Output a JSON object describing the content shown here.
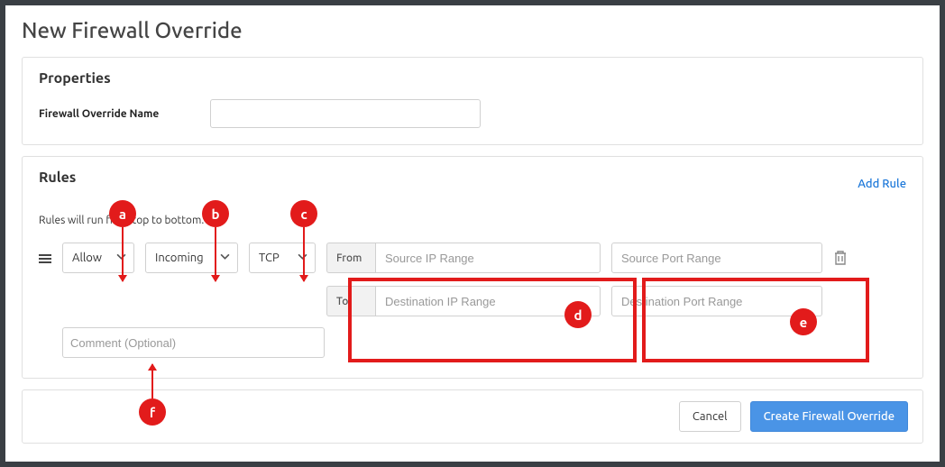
{
  "page": {
    "title": "New Firewall Override"
  },
  "properties": {
    "heading": "Properties",
    "name_label": "Firewall Override Name",
    "name_value": ""
  },
  "rules": {
    "heading": "Rules",
    "add_rule_label": "Add Rule",
    "note": "Rules will run from top to bottom.",
    "rule": {
      "action": "Allow",
      "direction": "Incoming",
      "protocol": "TCP",
      "from_label": "From",
      "to_label": "To",
      "source_ip_placeholder": "Source IP Range",
      "dest_ip_placeholder": "Destination IP Range",
      "source_port_placeholder": "Source Port Range",
      "dest_port_placeholder": "Destination Port Range",
      "comment_placeholder": "Comment (Optional)"
    }
  },
  "footer": {
    "cancel_label": "Cancel",
    "submit_label": "Create Firewall Override"
  },
  "annotations": {
    "a": "a",
    "b": "b",
    "c": "c",
    "d": "d",
    "e": "e",
    "f": "f"
  }
}
